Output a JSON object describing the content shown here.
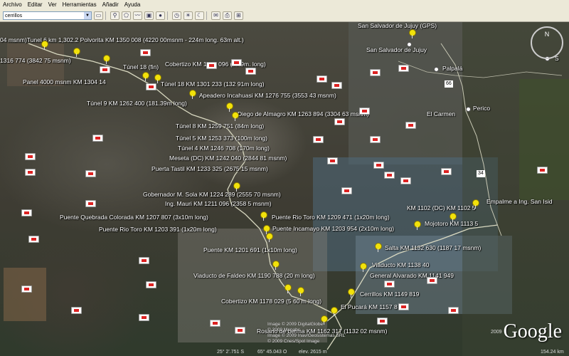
{
  "menu": [
    "Archivo",
    "Editar",
    "Ver",
    "Herramientas",
    "Añadir",
    "Ayuda"
  ],
  "search": {
    "value": "cerrillos"
  },
  "toolbar_icons": [
    "hide-sidebar-icon",
    "placemark-icon",
    "polygon-icon",
    "path-icon",
    "image-overlay-icon",
    "record-tour-icon",
    "historical-imagery-icon",
    "sun-icon",
    "sky-icon",
    "email-icon",
    "print-icon",
    "view-in-maps-icon"
  ],
  "compass": {
    "north_label": "N"
  },
  "places": [
    {
      "id": "san-salvador-gps",
      "text": "San Salvador de Jujuy (GPS)"
    },
    {
      "id": "san-salvador",
      "text": "San Salvador de Jujuy"
    },
    {
      "id": "palpala",
      "text": "Palpalá"
    },
    {
      "id": "el-carmen",
      "text": "El Carmen"
    },
    {
      "id": "perico",
      "text": "Perico"
    },
    {
      "id": "route-66",
      "text": "66"
    },
    {
      "id": "route-34",
      "text": "34"
    },
    {
      "id": "s-label",
      "text": "S"
    }
  ],
  "labels": [
    {
      "id": "polvorita",
      "text": "04 msnm)Tunel 6 km 1,302.2 Polvorita KM 1350 008 (4220 00msnm - 224m long. 63m alt.)"
    },
    {
      "id": "km1316",
      "text": "1316 774 (3842 75 msnm)"
    },
    {
      "id": "cobertizo-1294",
      "text": "Cobertizo KM 1294 096 (69.9m. long)"
    },
    {
      "id": "tunel-18-fin",
      "text": "Túnel 18 (fin)"
    },
    {
      "id": "panel-4000",
      "text": "Panel 4000 msnm KM 1304 14"
    },
    {
      "id": "tunel-18",
      "text": "Túnel 18 KM 1301 233 (132 91m long)"
    },
    {
      "id": "incahuasi",
      "text": "Apeadero Incahuasi KM 1276 755 (3553 43 msnm)"
    },
    {
      "id": "tunel-9",
      "text": "Túnel 9 KM 1262 400 (181.39m long)"
    },
    {
      "id": "diego-almagro",
      "text": "Diego de Almagro KM 1263 894 (3304 63 msnm)"
    },
    {
      "id": "tunel-8",
      "text": "Túnel 8 KM 1259 751 (84m long)"
    },
    {
      "id": "tunel-5",
      "text": "Túnel 5 KM 1253 373 (100m long)"
    },
    {
      "id": "tunel-4",
      "text": "Túnel 4 KM 1246 708 (170m long)"
    },
    {
      "id": "meseta",
      "text": "Meseta (DC) KM 1242 040 (2844 81 msnm)"
    },
    {
      "id": "puerta-tastil",
      "text": "Puerta Tastil KM 1233 325 (2675 15 msnm)"
    },
    {
      "id": "gobernador-sola",
      "text": "Gobernador M. Sola KM 1224 289 (2555 70 msnm)"
    },
    {
      "id": "ing-mauri",
      "text": "Ing. Mauri KM 1211 096 (2358 5 msnm)"
    },
    {
      "id": "quebrada-colorada",
      "text": "Puente Quebrada Colorada KM 1207 807 (3x10m long)"
    },
    {
      "id": "rio-toro-1209",
      "text": "Puente Rio Toro KM 1209 471 (1x20m long)"
    },
    {
      "id": "rio-toro-1203",
      "text": "Puente Rio Toro KM 1203 391 (1x20m long)"
    },
    {
      "id": "incamayo",
      "text": "Puente Incamayo KM 1203 954 (2x10m long)"
    },
    {
      "id": "puente-1201",
      "text": "Puente KM 1201 691 (1x10m long)"
    },
    {
      "id": "km1102",
      "text": "KM 1102 (DC) KM 1102 5"
    },
    {
      "id": "empalme",
      "text": "Empalme a Ing. San Isid"
    },
    {
      "id": "mojotoro",
      "text": "Mojotoro KM 1113 5"
    },
    {
      "id": "salta",
      "text": "Salta KM 1132 630 (1187 17 msnm)"
    },
    {
      "id": "viaducto-1138",
      "text": "Viaducto KM 1138 40"
    },
    {
      "id": "general-alvarado",
      "text": "General Alvarado KM 1141 949"
    },
    {
      "id": "viaducto-faldeo",
      "text": "Viaducto de Faldeo KM 1190 788 (20 m long)"
    },
    {
      "id": "cerrillos",
      "text": "Cerrillos KM 1149 819"
    },
    {
      "id": "el-pucara",
      "text": "El Pucará KM 1157 8"
    },
    {
      "id": "cobertizo-1178",
      "text": "Cobertizo KM 1178 029 (5 60 m long)"
    },
    {
      "id": "rosario",
      "text": "Rosario de Lerma KM 1162 317 (1132 02 msnm)"
    }
  ],
  "copyright": [
    "Image © 2009 DigitalGlobe",
    "© 2009 Mapabc",
    "Image © 2009 Inav/Geosistemas SRL",
    "© 2009 Cnes/Spot Image"
  ],
  "logo": "Google",
  "status": {
    "lat": "25° 2'.751 S",
    "lon": "65° 45.043 O",
    "elev": "elev. 2615 m",
    "eye": "154.24 km",
    "year": "2009"
  },
  "colors": {
    "pin": "#f2e20a",
    "route": "#d8d8c0",
    "youtube": "#d22222"
  }
}
